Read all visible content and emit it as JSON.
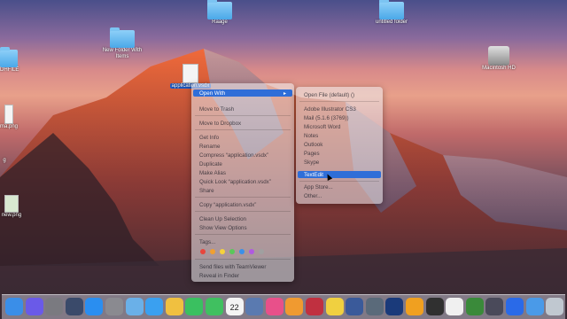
{
  "desktop_icons": [
    {
      "label": "Raage"
    },
    {
      "label": "untitled folder"
    },
    {
      "label": "New Folder With Items"
    },
    {
      "label": "Macintosh HD"
    },
    {
      "label": "DHFILE"
    },
    {
      "label": "ma.png"
    },
    {
      "label": "g"
    },
    {
      "label": "new.png"
    },
    {
      "label": "application.vsdx"
    }
  ],
  "context_menu": {
    "items": [
      "Open With",
      "Move to Trash",
      "Move to Dropbox",
      "Get Info",
      "Rename",
      "Compress “application.vsdx”",
      "Duplicate",
      "Make Alias",
      "Quick Look “application.vsdx”",
      "Share",
      "Copy “application.vsdx”",
      "Clean Up Selection",
      "Show View Options",
      "Tags...",
      "Send files with TeamViewer",
      "Reveal in Finder"
    ],
    "tag_colors": [
      "#e8453c",
      "#f0a030",
      "#f5d23c",
      "#5ac85a",
      "#3a90e8",
      "#b05ae0",
      "#a0a0a0"
    ]
  },
  "submenu": {
    "items": [
      "Open File (default) ()",
      "Adobe Illustrator CS3",
      "Mail (5.1.6 (3769))",
      "Microsoft Word",
      "Notes",
      "Outlook",
      "Pages",
      "Skype",
      "TextEdit",
      "App Store...",
      "Other..."
    ],
    "highlighted": "TextEdit"
  },
  "dock": {
    "apps": [
      "finder-icon",
      "siri-icon",
      "launchpad-icon",
      "mission-control-icon",
      "app-store-icon",
      "system-preferences-icon",
      "preview-icon",
      "safari-icon",
      "photos-icon",
      "facetime-icon",
      "messages-icon",
      "calendar-icon",
      "keynote-icon",
      "itunes-icon",
      "ibooks-icon",
      "photo-booth-icon",
      "notes-icon",
      "lightroom-icon",
      "time-machine-icon",
      "photoshop-icon",
      "pages-icon",
      "terminal-icon",
      "chrome-icon",
      "camtasia-icon",
      "finalcut-icon",
      "teamviewer-icon",
      "downloads-icon",
      "trash-icon"
    ],
    "calendar_day": "22"
  }
}
